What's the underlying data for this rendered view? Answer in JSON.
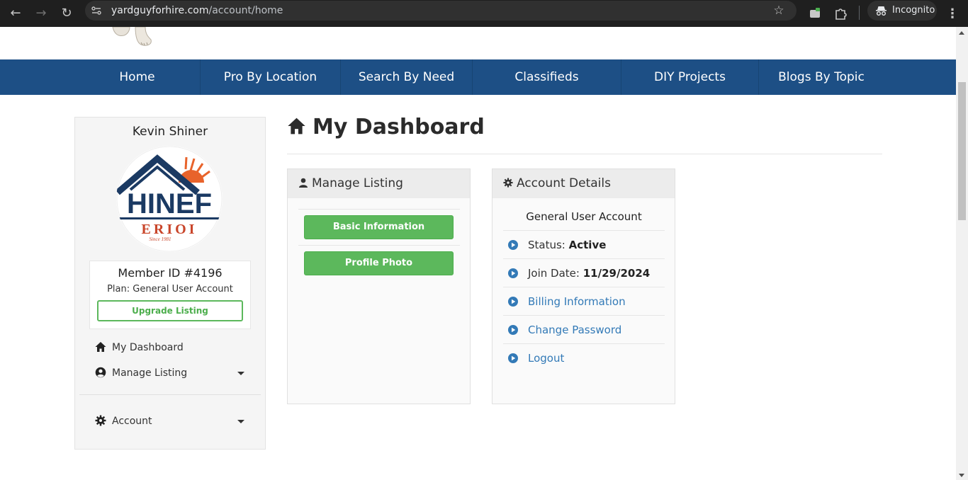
{
  "browser": {
    "url_domain": "yardguyforhire.com",
    "url_path": "/account/home",
    "incognito_label": "Incognito"
  },
  "nav": {
    "items": [
      {
        "label": "Home"
      },
      {
        "label": "Pro By Location"
      },
      {
        "label": "Search By Need"
      },
      {
        "label": "Classifieds"
      },
      {
        "label": "DIY Projects"
      },
      {
        "label": "Blogs By Topic"
      }
    ]
  },
  "sidebar": {
    "user_name": "Kevin Shiner",
    "avatar_text_main": "HINEF",
    "avatar_text_sub": "ERIOI",
    "avatar_since": "Since 1981",
    "member_id": "Member ID #4196",
    "plan": "Plan: General User Account",
    "upgrade_label": "Upgrade Listing",
    "links": {
      "dashboard": "My Dashboard",
      "manage_listing": "Manage Listing",
      "account": "Account"
    }
  },
  "dashboard": {
    "title": "My Dashboard",
    "manage_panel": {
      "title": "Manage Listing",
      "basic_info": "Basic Information",
      "profile_photo": "Profile Photo"
    },
    "account_panel": {
      "title": "Account Details",
      "account_type": "General User Account",
      "status_label": "Status:",
      "status_value": "Active",
      "join_label": "Join Date:",
      "join_value": "11/29/2024",
      "billing": "Billing Information",
      "change_password": "Change Password",
      "logout": "Logout"
    }
  },
  "colors": {
    "nav_bg": "#1d4f85",
    "button_green": "#5cb85c",
    "link_blue": "#337ab7"
  }
}
